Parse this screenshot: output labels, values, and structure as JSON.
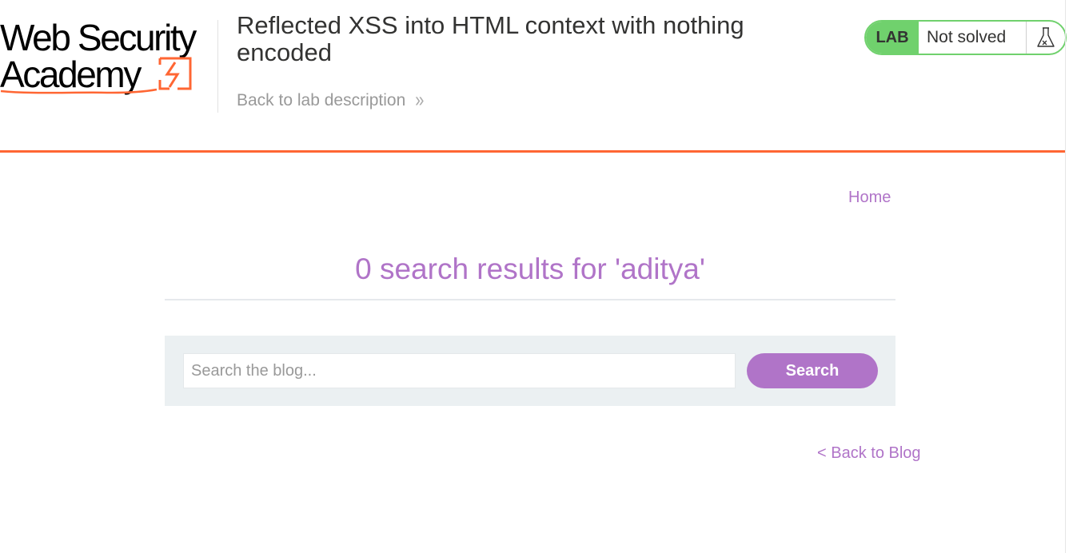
{
  "header": {
    "logo": {
      "line1": "Web Security",
      "line2": "Academy"
    },
    "lab_title": "Reflected XSS into HTML context with nothing encoded",
    "back_link": "Back to lab description",
    "back_chevron": "»",
    "status": {
      "badge": "LAB",
      "text": "Not solved",
      "icon": "flask-icon"
    }
  },
  "nav": {
    "home": "Home"
  },
  "main": {
    "results_heading": "0 search results for 'aditya'",
    "search": {
      "placeholder": "Search the blog...",
      "value": "",
      "button_label": "Search"
    },
    "back_to_blog": "< Back to Blog"
  },
  "colors": {
    "accent": "#b074c8",
    "brand_orange": "#ff6633",
    "lab_green": "#70d16d",
    "panel_bg": "#ebf0f2"
  }
}
